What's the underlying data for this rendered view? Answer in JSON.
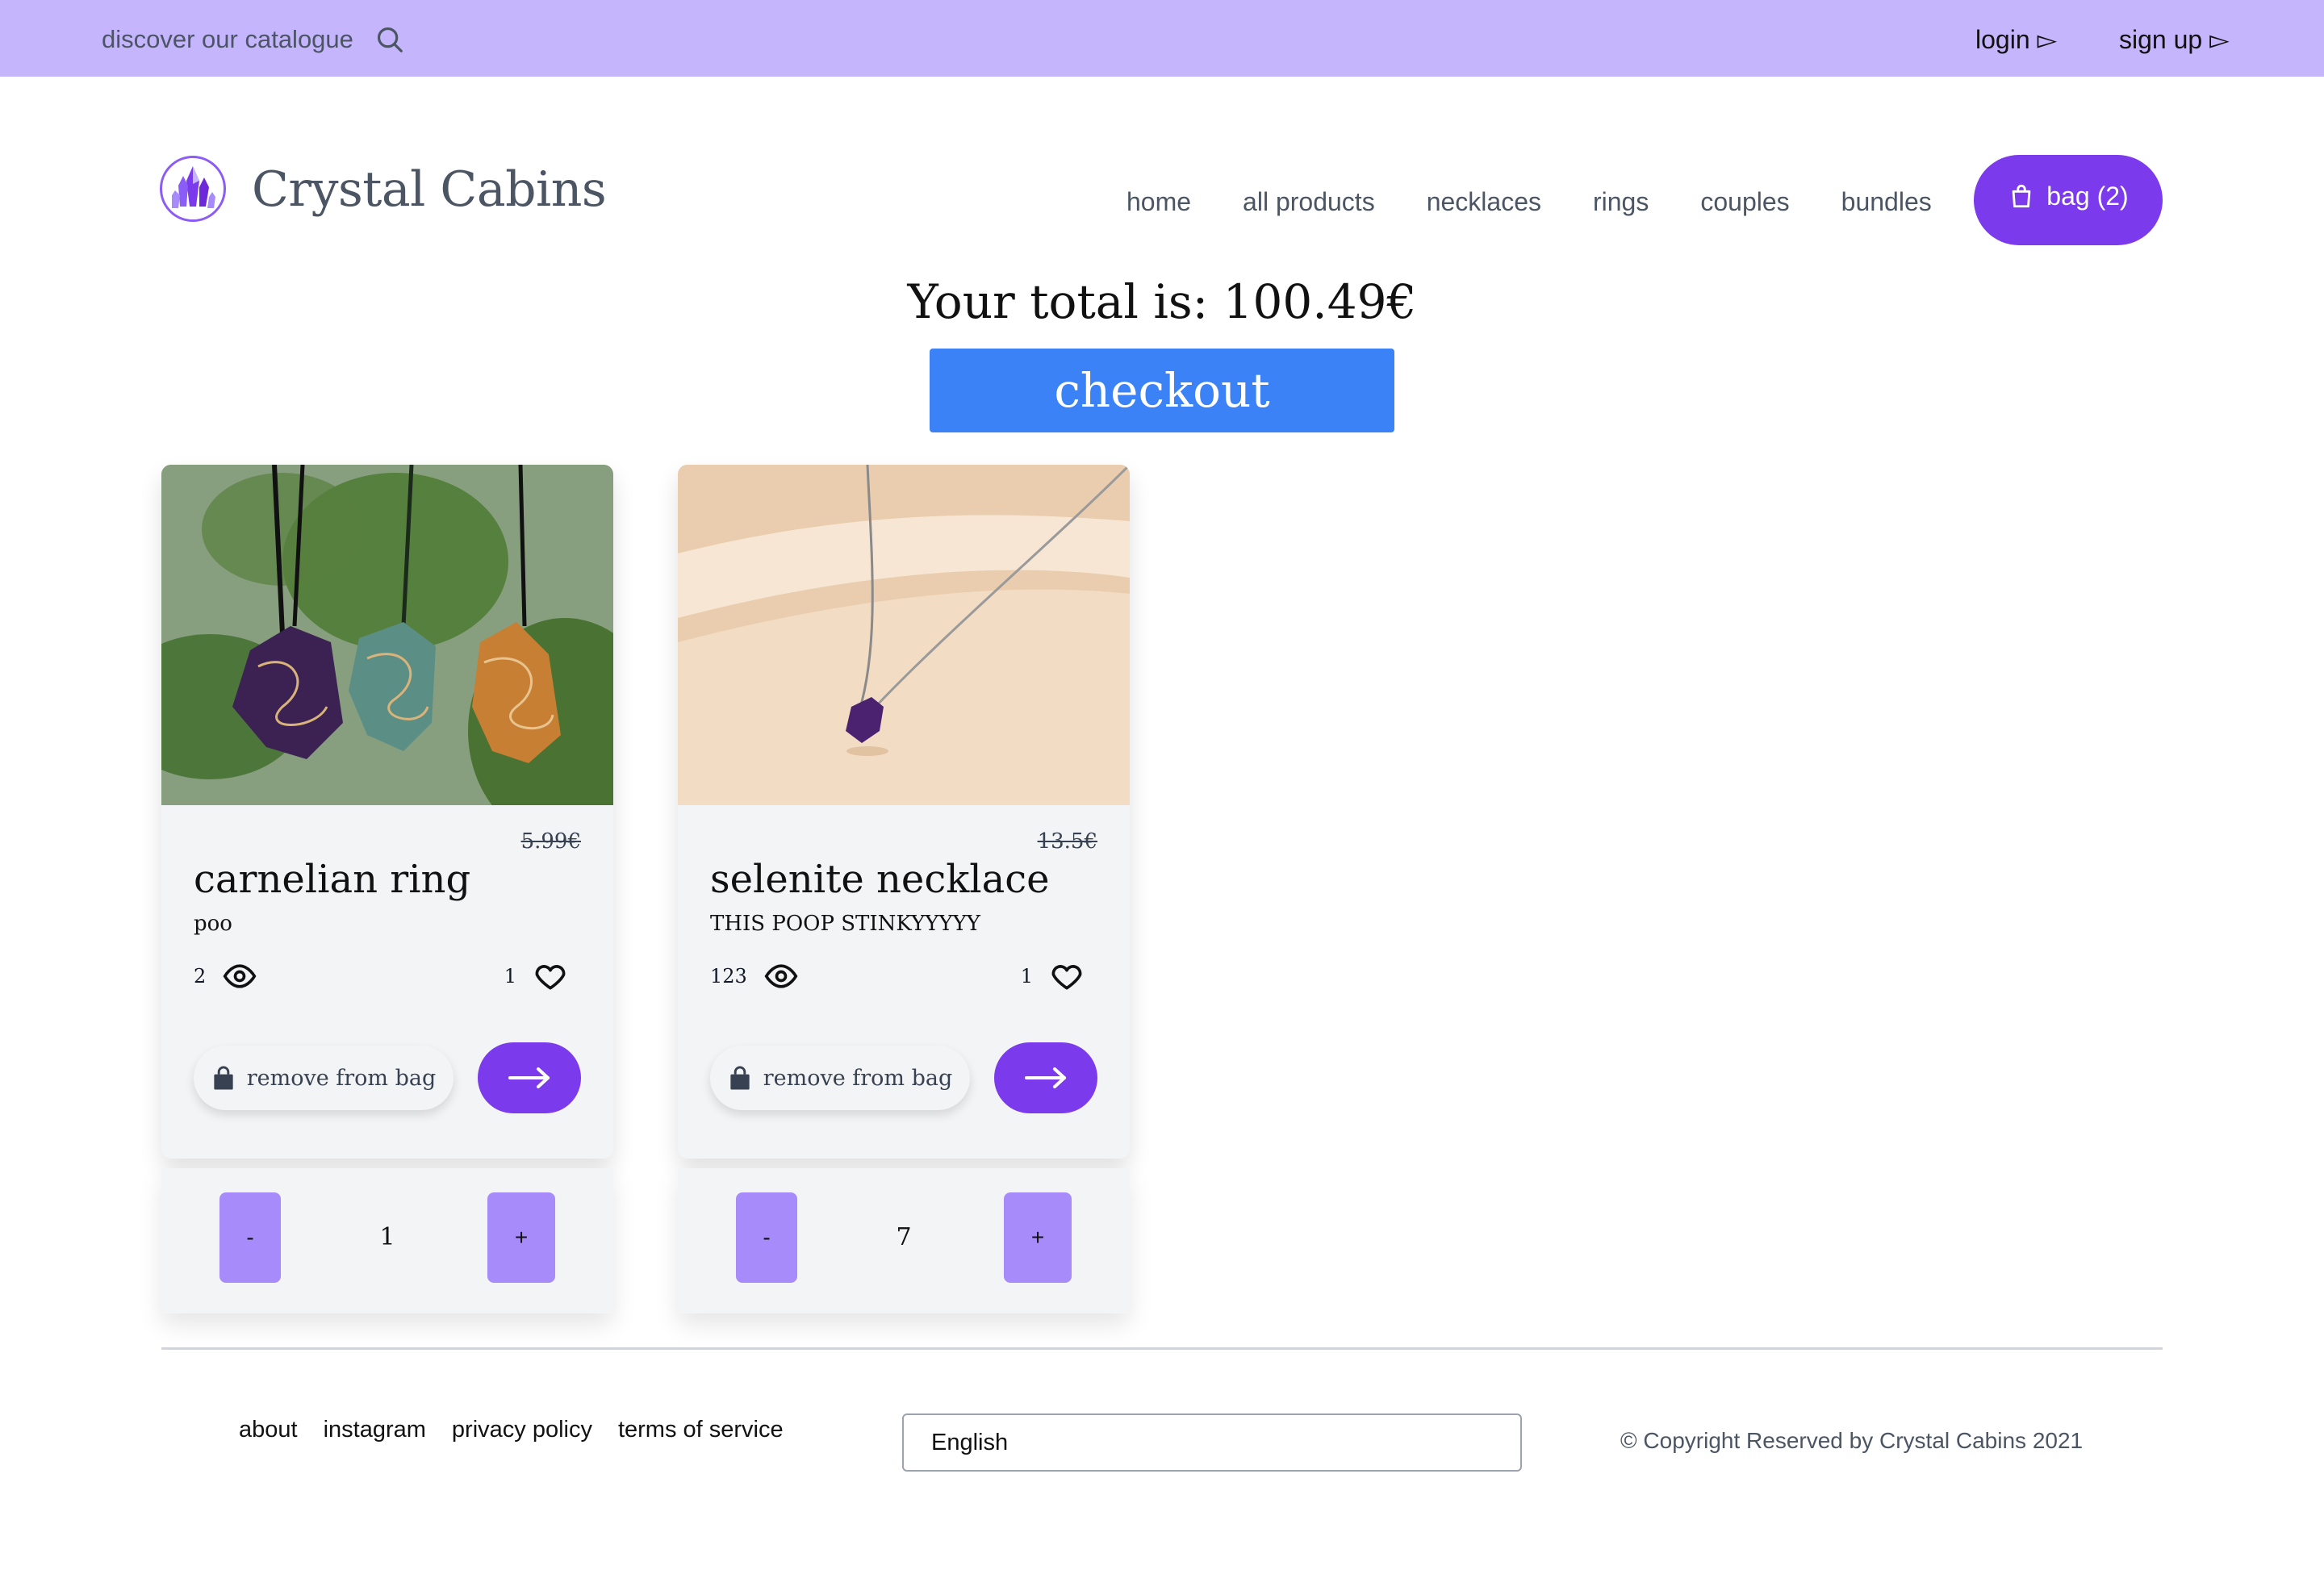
{
  "topbar": {
    "search_label": "discover our catalogue",
    "login_label": "login ▻",
    "signup_label": "sign up ▻",
    "bg_color": "#c4b5fd"
  },
  "header": {
    "brand": "Crystal Cabins",
    "nav": [
      "home",
      "all products",
      "necklaces",
      "rings",
      "couples",
      "bundles"
    ],
    "bag_label": "bag (2)",
    "accent_color": "#7c3aed"
  },
  "cart": {
    "total_text": "Your total is: 100.49€",
    "checkout_label": "checkout",
    "items": [
      {
        "name": "carnelian ring",
        "price": "5.99€",
        "description": "poo",
        "views": "2",
        "likes": "1",
        "remove_label": "remove from bag",
        "quantity": "1",
        "minus_label": "-",
        "plus_label": "+",
        "image": "crystal-pendants-photo"
      },
      {
        "name": "selenite necklace",
        "price": "13.5€",
        "description": "THIS POOP STINKYYYYY",
        "views": "123",
        "likes": "1",
        "remove_label": "remove from bag",
        "quantity": "7",
        "minus_label": "-",
        "plus_label": "+",
        "image": "amethyst-necklace-photo"
      }
    ]
  },
  "footer": {
    "links": [
      "about",
      "instagram",
      "privacy policy",
      "terms of service"
    ],
    "language": "English",
    "copyright": "© Copyright Reserved by Crystal Cabins 2021"
  }
}
